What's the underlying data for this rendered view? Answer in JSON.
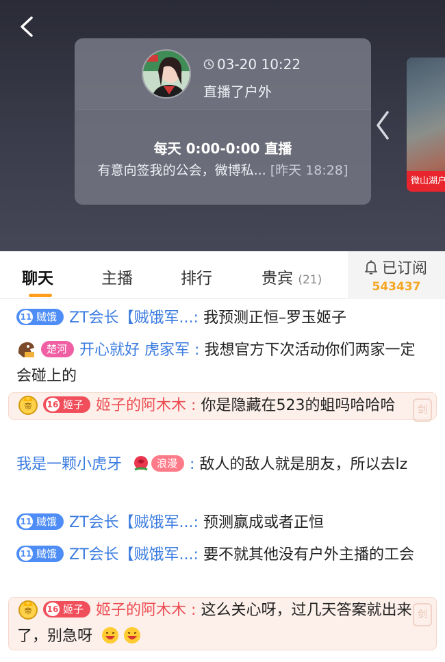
{
  "header": {
    "time": "03-20 10:22",
    "live_desc": "直播了户外",
    "schedule": "每天 0:00-0:00 直播",
    "notice_text": "有意向签我的公会，微博私...",
    "notice_time": "[昨天 18:28]",
    "thumb_label": "微山湖户"
  },
  "tabs": {
    "chat": "聊天",
    "anchor": "主播",
    "rank": "排行",
    "vip": "贵宾",
    "vip_count": "(21)",
    "subscribe_label": "已订阅",
    "subscribe_count": "543437"
  },
  "chat": [
    {
      "badge_num": "11",
      "badge": "贼饿",
      "nick": "ZT会长【贼饿军...",
      "sep": ":",
      "text": "我预测正恒–罗玉姬子"
    },
    {
      "badge": "楚河",
      "nick": "开心就好 虎家军",
      "sep": ":",
      "text": "我想官方下次活动你们两家一定会碰上的"
    },
    {
      "badge_num": "16",
      "badge": "姬子",
      "nick": "姬子的阿木木",
      "sep": ":",
      "text": "你是隐藏在523的蛆吗哈哈哈"
    },
    {
      "nick": "我是一颗小虎牙",
      "badge": "浪漫",
      "sep": ":",
      "text": "敌人的敌人就是朋友，所以去lz"
    },
    {
      "badge_num": "11",
      "badge": "贼饿",
      "nick": "ZT会长【贼饿军...",
      "sep": ":",
      "text": "预测赢成或者正恒"
    },
    {
      "badge_num": "11",
      "badge": "贼饿",
      "nick": "ZT会长【贼饿军...",
      "sep": ":",
      "text": "要不就其他没有户外主播的工会"
    },
    {
      "badge_num": "16",
      "badge": "姬子",
      "nick": "姬子的阿木木",
      "sep": ":",
      "text": "这么关心呀，过几天答案就出来了，别急呀"
    }
  ],
  "colors": {
    "accent": "#ff9f1c",
    "nick_blue": "#3a7be0",
    "nick_red": "#ec4b52",
    "sub_count": "#f5a623"
  }
}
